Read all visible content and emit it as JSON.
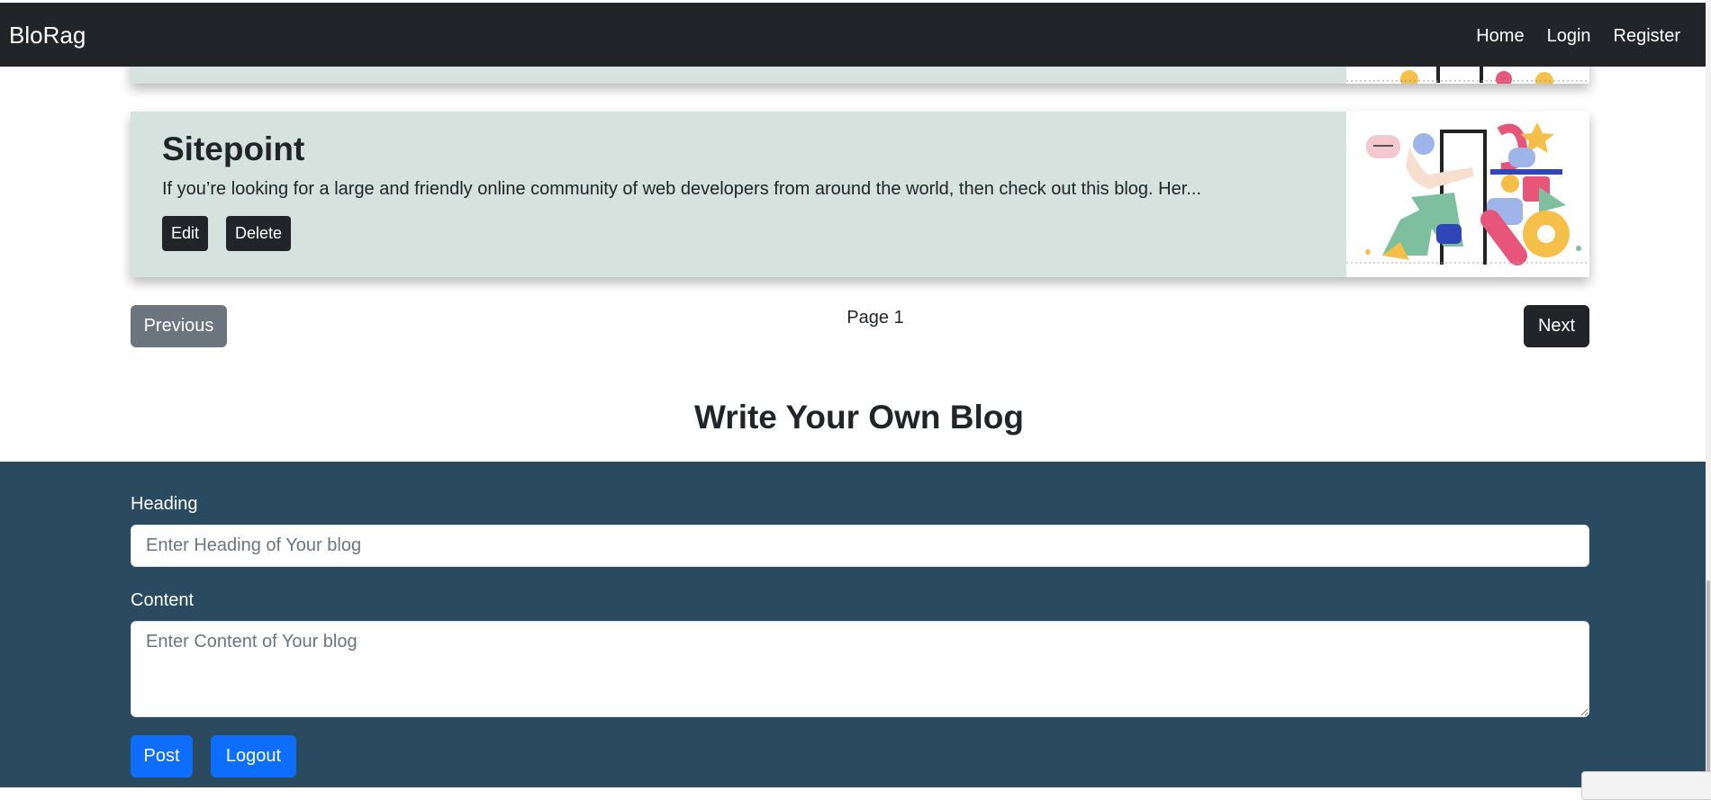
{
  "navbar": {
    "brand": "BloRag",
    "links": [
      "Home",
      "Login",
      "Register"
    ]
  },
  "blog_card": {
    "title": "Sitepoint",
    "excerpt": "If you’re looking for a large and friendly online community of web developers from around the world, then check out this blog. Her...",
    "edit_label": "Edit",
    "delete_label": "Delete"
  },
  "pagination": {
    "previous_label": "Previous",
    "page_label": "Page 1",
    "next_label": "Next"
  },
  "write_section": {
    "title": "Write Your Own Blog",
    "heading_label": "Heading",
    "heading_placeholder": "Enter Heading of Your blog",
    "content_label": "Content",
    "content_placeholder": "Enter Content of Your blog",
    "post_label": "Post",
    "logout_label": "Logout"
  },
  "colors": {
    "navbar_bg": "#212529",
    "card_bg": "#d6e2de",
    "form_section_bg": "#2a4a60",
    "primary": "#0d6efd",
    "secondary": "#6c757d"
  }
}
